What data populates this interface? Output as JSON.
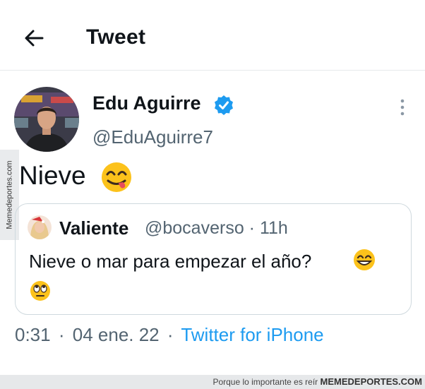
{
  "header": {
    "back_icon": "arrow-left-icon",
    "title": "Tweet"
  },
  "tweet": {
    "author": {
      "name": "Edu Aguirre",
      "handle": "@EduAguirre7",
      "verified": true,
      "verified_color": "#1d9bf0"
    },
    "text": "Nieve",
    "emoji": "face-savoring-food-emoji",
    "quoted": {
      "name": "Valiente",
      "handle_time": "@bocaverso · 11h",
      "text": "Nieve o mar para empezar el año?",
      "emojis": [
        "grinning-face-emoji",
        "rolling-eyes-emoji"
      ]
    },
    "meta": {
      "time": "0:31",
      "date": "04 ene. 22",
      "separator": "·",
      "source": "Twitter for iPhone"
    }
  },
  "watermarks": {
    "side": "Memedeportes.com",
    "footer_tagline": "Porque lo importante es reír",
    "footer_brand": "MEMEDEPORTES.COM"
  },
  "colors": {
    "text": "#0f1419",
    "secondary": "#536471",
    "link": "#1d9bf0",
    "border": "#cfd9de"
  }
}
